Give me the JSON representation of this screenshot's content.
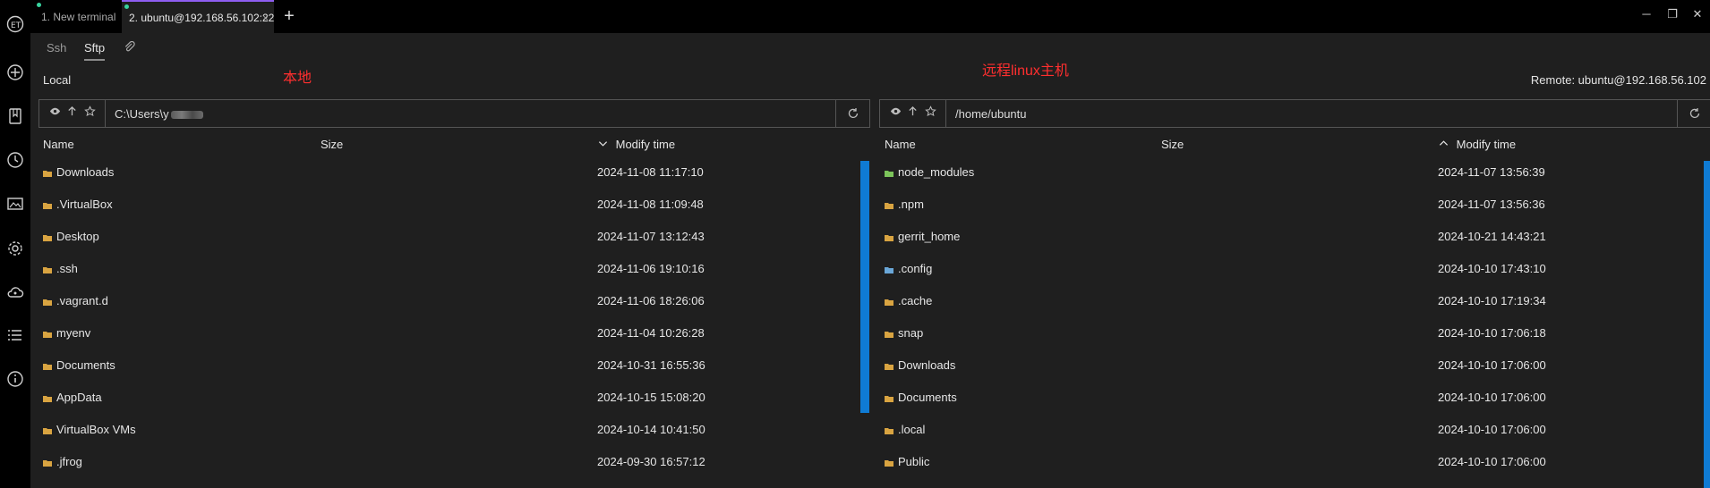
{
  "tabs": [
    {
      "label": "1. New terminal"
    },
    {
      "label": "2. ubuntu@192.168.56.102:22",
      "active": true
    }
  ],
  "sub_tabs": {
    "ssh": "Ssh",
    "sftp": "Sftp",
    "active": "Sftp"
  },
  "local": {
    "label": "Local",
    "annotation": "本地",
    "path": "C:\\Users\\y",
    "columns": {
      "name": "Name",
      "size": "Size",
      "modify": "Modify time",
      "sort": "desc"
    },
    "files": [
      {
        "name": "Downloads",
        "date": "2024-11-08 11:17:10"
      },
      {
        "name": ".VirtualBox",
        "date": "2024-11-08 11:09:48"
      },
      {
        "name": "Desktop",
        "date": "2024-11-07 13:12:43"
      },
      {
        "name": ".ssh",
        "date": "2024-11-06 19:10:16"
      },
      {
        "name": ".vagrant.d",
        "date": "2024-11-06 18:26:06"
      },
      {
        "name": "myenv",
        "date": "2024-11-04 10:26:28"
      },
      {
        "name": "Documents",
        "date": "2024-10-31 16:55:36"
      },
      {
        "name": "AppData",
        "date": "2024-10-15 15:08:20"
      },
      {
        "name": "VirtualBox VMs",
        "date": "2024-10-14 10:41:50"
      },
      {
        "name": ".jfrog",
        "date": "2024-09-30 16:57:12"
      }
    ]
  },
  "remote": {
    "label": "Remote: ubuntu@192.168.56.102",
    "annotation": "远程linux主机",
    "path": "/home/ubuntu",
    "columns": {
      "name": "Name",
      "size": "Size",
      "modify": "Modify time",
      "sort": "asc"
    },
    "files": [
      {
        "name": "node_modules",
        "date": "2024-11-07 13:56:39",
        "icon": "green"
      },
      {
        "name": ".npm",
        "date": "2024-11-07 13:56:36"
      },
      {
        "name": "gerrit_home",
        "date": "2024-10-21 14:43:21"
      },
      {
        "name": ".config",
        "date": "2024-10-10 17:43:10",
        "icon": "blue"
      },
      {
        "name": ".cache",
        "date": "2024-10-10 17:19:34"
      },
      {
        "name": "snap",
        "date": "2024-10-10 17:06:18"
      },
      {
        "name": "Downloads",
        "date": "2024-10-10 17:06:00"
      },
      {
        "name": "Documents",
        "date": "2024-10-10 17:06:00"
      },
      {
        "name": ".local",
        "date": "2024-10-10 17:06:00"
      },
      {
        "name": "Public",
        "date": "2024-10-10 17:06:00"
      }
    ]
  },
  "colors": {
    "accent": "#0f7bd4",
    "annotation": "#ff2f2f",
    "folder": "#d9a441"
  }
}
